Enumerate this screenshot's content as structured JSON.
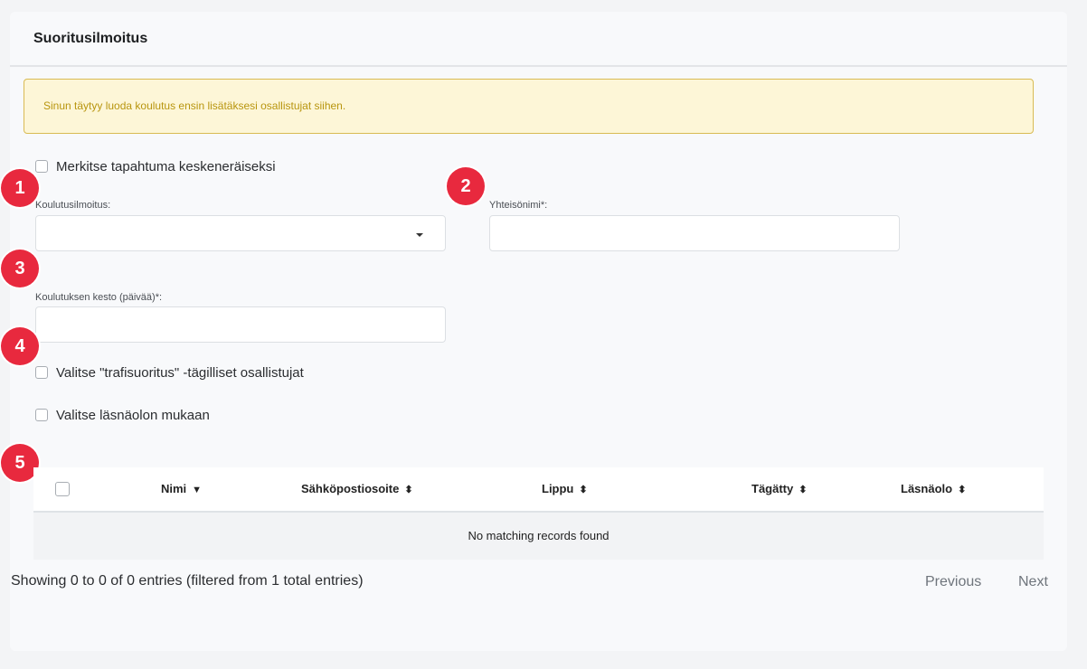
{
  "card": {
    "title": "Suoritusilmoitus"
  },
  "alert": {
    "text": "Sinun täytyy luoda koulutus ensin lisätäksesi osallistujat siihen."
  },
  "form": {
    "mark_incomplete_label": "Merkitse tapahtuma keskeneräiseksi",
    "training_notice_label": "Koulutusilmoitus:",
    "training_notice_value": "",
    "community_name_label": "Yhteisönimi*:",
    "community_name_value": "",
    "duration_label": "Koulutuksen kesto (päivää)*:",
    "duration_value": "",
    "select_trafi_label": "Valitse \"trafisuoritus\" -tägilliset osallistujat",
    "select_attendance_label": "Valitse läsnäolon mukaan"
  },
  "badges": [
    "1",
    "2",
    "3",
    "4",
    "5"
  ],
  "table": {
    "columns": [
      {
        "label": "Nimi",
        "sort": "▼"
      },
      {
        "label": "Sähköpostiosoite",
        "sort": "⬍"
      },
      {
        "label": "Lippu",
        "sort": "⬍"
      },
      {
        "label": "Tägätty",
        "sort": "⬍"
      },
      {
        "label": "Läsnäolo",
        "sort": "⬍"
      }
    ],
    "empty_text": "No matching records found"
  },
  "footer": {
    "info": "Showing 0 to 0 of 0 entries (filtered from 1 total entries)",
    "previous": "Previous",
    "next": "Next"
  },
  "colors": {
    "badge": "#e8293e",
    "alert_bg": "#fdf6d7",
    "alert_border": "#d9bb53",
    "alert_text": "#b8950e"
  }
}
